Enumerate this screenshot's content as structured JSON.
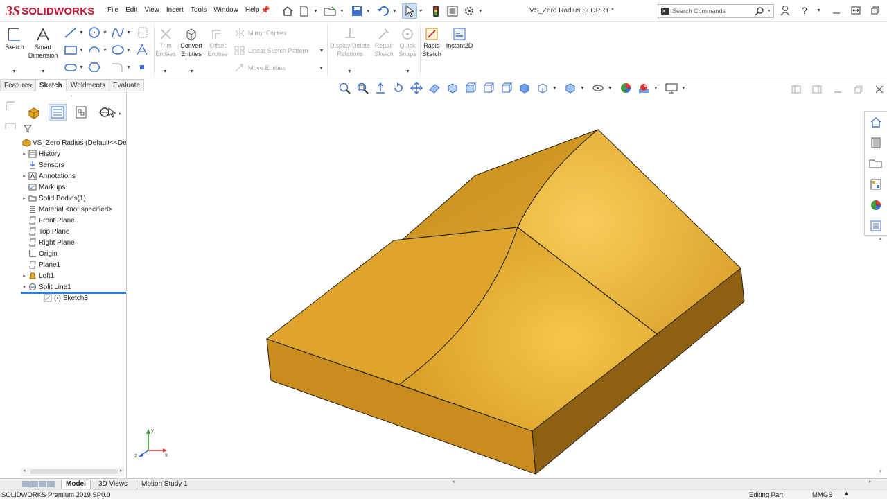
{
  "app": {
    "logo_prefix": "3S",
    "logo_text": "SOLIDWORKS",
    "doc_title": "VS_Zero Radius.SLDPRT *"
  },
  "menu": [
    "File",
    "Edit",
    "View",
    "Insert",
    "Tools",
    "Window",
    "Help"
  ],
  "search": {
    "placeholder": "Search Commands"
  },
  "ribbon": {
    "sketch": "Sketch",
    "smart_dimension": "Smart Dimension",
    "trim_entities": "Trim Entities",
    "convert_entities": "Convert Entities",
    "offset_entities": "Offset Entities",
    "mirror_entities": "Mirror Entities",
    "linear_sketch_pattern": "Linear Sketch Pattern",
    "move_entities": "Move Entities",
    "display_delete_relations": "Display/Delete Relations",
    "repair_sketch": "Repair Sketch",
    "quick_snaps": "Quick Snaps",
    "rapid_sketch": "Rapid Sketch",
    "instant2d": "Instant2D"
  },
  "tabs": [
    "Features",
    "Sketch",
    "Weldments",
    "Evaluate"
  ],
  "tree": {
    "root": "VS_Zero Radius  (Default<<De",
    "items": [
      {
        "label": "History",
        "expander": "▸"
      },
      {
        "label": "Sensors",
        "expander": ""
      },
      {
        "label": "Annotations",
        "expander": "▸"
      },
      {
        "label": "Markups",
        "expander": ""
      },
      {
        "label": "Solid Bodies(1)",
        "expander": "▸"
      },
      {
        "label": "Material <not specified>",
        "expander": ""
      },
      {
        "label": "Front Plane",
        "expander": ""
      },
      {
        "label": "Top Plane",
        "expander": ""
      },
      {
        "label": "Right Plane",
        "expander": ""
      },
      {
        "label": "Origin",
        "expander": ""
      },
      {
        "label": "Plane1",
        "expander": ""
      },
      {
        "label": "Loft1",
        "expander": "▸"
      },
      {
        "label": "Split Line1",
        "expander": "▾"
      },
      {
        "label": "(-) Sketch3",
        "expander": ""
      }
    ]
  },
  "bottom_tabs": [
    "Model",
    "3D Views",
    "Motion Study 1"
  ],
  "status": {
    "left": "SOLIDWORKS Premium 2019 SP0.0",
    "editing": "Editing Part",
    "units": "MMGS"
  },
  "triad": {
    "x": "x",
    "y": "y",
    "z": "z"
  },
  "colors": {
    "part_face": "#d9a02a",
    "part_top_light": "#f3c044",
    "part_side_dark": "#8f6314",
    "accent_red": "#c8102e",
    "selection_blue": "#2f7cd8"
  }
}
